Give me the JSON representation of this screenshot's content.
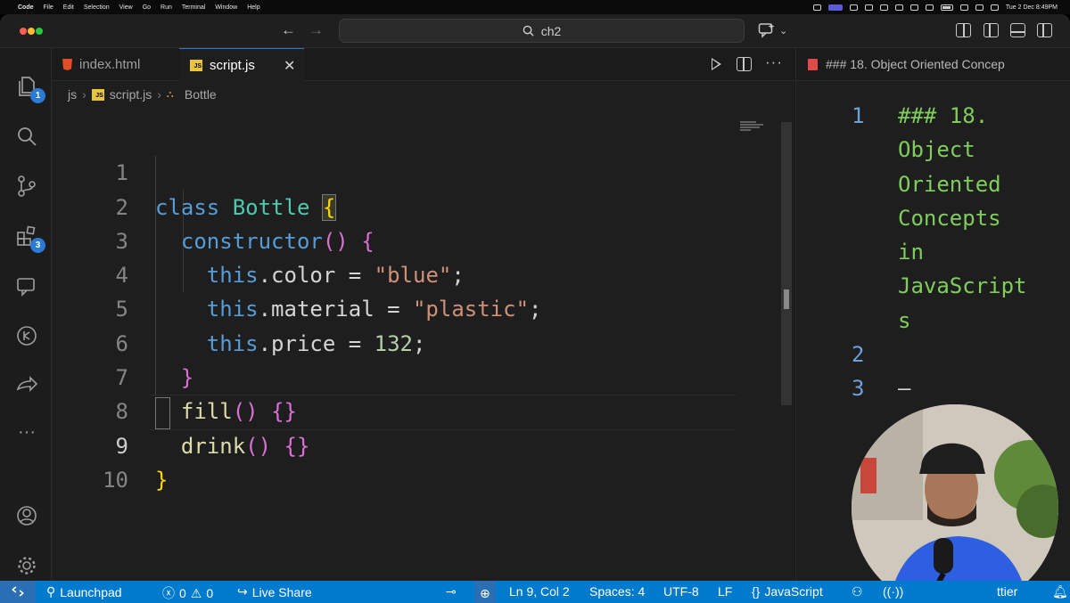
{
  "menubar": {
    "items": [
      "Code",
      "File",
      "Edit",
      "Selection",
      "View",
      "Go",
      "Run",
      "Terminal",
      "Window",
      "Help"
    ],
    "clock": "Tue 2 Dec  8:49PM"
  },
  "titlebar": {
    "search_text": "ch2"
  },
  "activity": {
    "explorer_badge": "1",
    "extensions_badge": "3"
  },
  "tabs": [
    {
      "label": "index.html",
      "icon": "html5-icon"
    },
    {
      "label": "script.js",
      "icon": "js-icon"
    }
  ],
  "breadcrumb": {
    "folder": "js",
    "file": "script.js",
    "symbol": "Bottle"
  },
  "code_lines": [
    "class Bottle {",
    "  constructor() {",
    "    this.color = \"blue\";",
    "    this.material = \"plastic\";",
    "    this.price = 132;",
    "  }",
    "  fill() {}",
    "  drink() {}",
    "}",
    ""
  ],
  "line_numbers": [
    "1",
    "2",
    "3",
    "4",
    "5",
    "6",
    "7",
    "8",
    "9",
    "10"
  ],
  "preview": {
    "tab_title": "### 18. Object Oriented Concep",
    "lines": [
      {
        "n": "1",
        "text": [
          "### 18.",
          "Object",
          "Oriented",
          "Concepts",
          "in",
          "JavaScript",
          "s"
        ]
      },
      {
        "n": "2",
        "text": [
          ""
        ]
      },
      {
        "n": "3",
        "text": [
          "–"
        ]
      }
    ]
  },
  "statusbar": {
    "launchpad": "Launchpad",
    "errors": "0",
    "warnings": "0",
    "live_share": "Live Share",
    "position": "Ln 9, Col 2",
    "spaces": "Spaces: 4",
    "encoding": "UTF-8",
    "eol": "LF",
    "language": "JavaScript",
    "prettier": "ttier"
  },
  "colors": {
    "statusbar": "#007acc",
    "badge": "#2b7bd6",
    "keyword": "#569cd6",
    "class": "#4ec9b0",
    "function": "#dcdcaa",
    "string": "#ce9178",
    "number": "#b5cea8",
    "bracket_1": "#ffd700",
    "bracket_2": "#da70d6"
  }
}
